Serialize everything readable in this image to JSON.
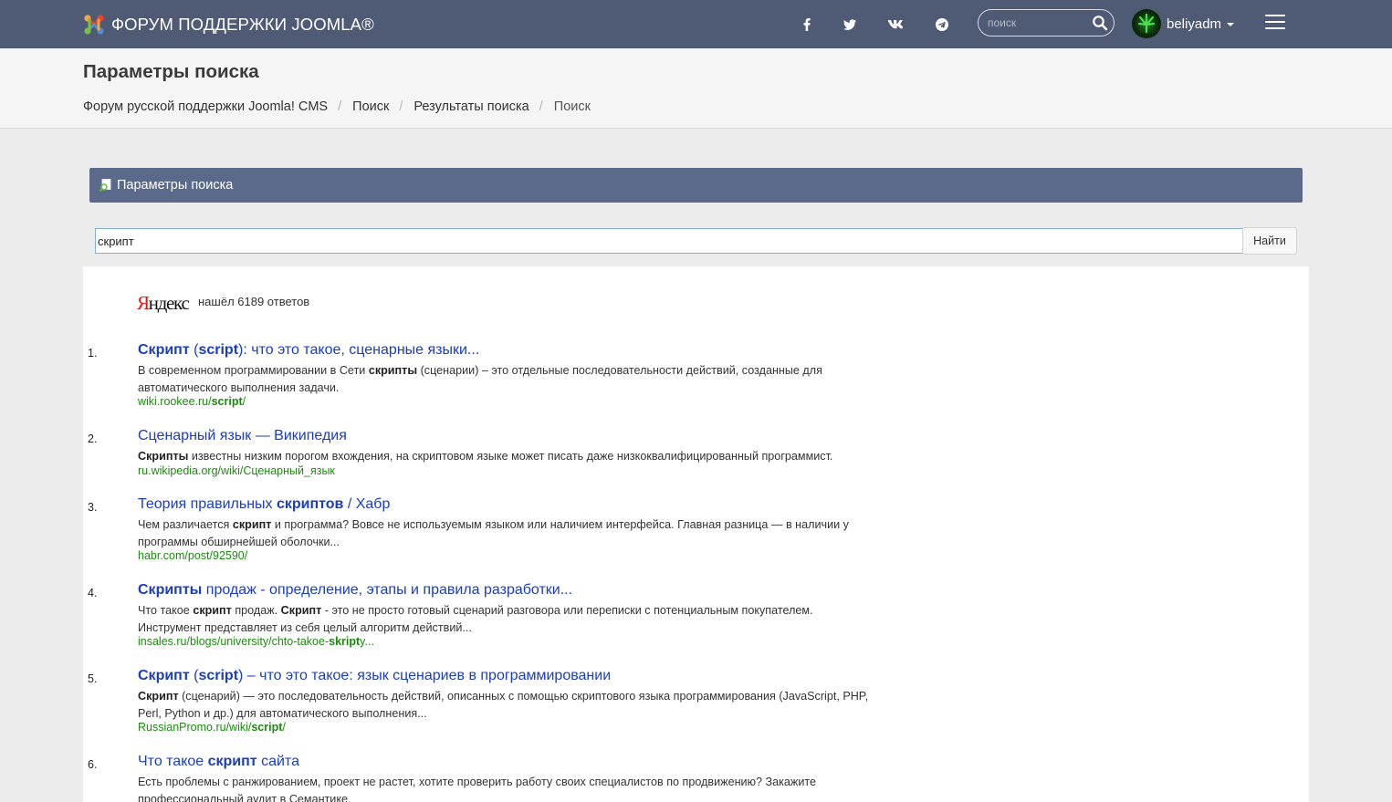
{
  "navbar": {
    "brand": "ФОРУМ ПОДДЕРЖКИ JOOMLA®",
    "social": [
      "facebook-icon",
      "twitter-icon",
      "vk-icon",
      "telegram-icon"
    ],
    "search_placeholder": "поиск",
    "username": "beliyadm"
  },
  "header": {
    "title": "Параметры поиска",
    "breadcrumbs": [
      "Форум русской поддержки Joomla! CMS",
      "Поиск",
      "Результаты поиска",
      "Поиск"
    ]
  },
  "panel": {
    "title": "Параметры поиска",
    "query": "скрипт",
    "button": "Найти"
  },
  "yandex": {
    "logo": "Яндекс",
    "found": "нашёл 6189 ответов"
  },
  "results": [
    {
      "num": "1.",
      "title": [
        [
          "b",
          "Скрипт"
        ],
        [
          "t",
          " ("
        ],
        [
          "b",
          "script"
        ],
        [
          "t",
          "): что это такое, сценарные языки..."
        ]
      ],
      "snippet": [
        [
          "t",
          "В современном программировании в Сети "
        ],
        [
          "b",
          "скрипты"
        ],
        [
          "t",
          " (сценарии) – это отдельные последовательности действий, созданные для автоматического выполнения задачи."
        ]
      ],
      "url": [
        [
          "t",
          "wiki.rookee.ru/"
        ],
        [
          "b",
          "script"
        ],
        [
          "t",
          "/"
        ]
      ]
    },
    {
      "num": "2.",
      "title": [
        [
          "t",
          "Сценарный язык — Википедия"
        ]
      ],
      "snippet": [
        [
          "b",
          "Скрипты"
        ],
        [
          "t",
          " известны низким порогом вхождения, на скриптовом языке может писать даже низкоквалифицированный программист."
        ]
      ],
      "url": [
        [
          "t",
          "ru.wikipedia.org/wiki/Сценарный_язык"
        ]
      ]
    },
    {
      "num": "3.",
      "title": [
        [
          "t",
          "Теория правильных "
        ],
        [
          "b",
          "скриптов"
        ],
        [
          "t",
          " / Хабр"
        ]
      ],
      "snippet": [
        [
          "t",
          "Чем различается "
        ],
        [
          "b",
          "скрипт"
        ],
        [
          "t",
          " и программа? Вовсе не используемым языком или наличием интерфейса. Главная разница — в наличии у программы обширнейшей оболочки..."
        ]
      ],
      "url": [
        [
          "t",
          "habr.com/post/92590/"
        ]
      ]
    },
    {
      "num": "4.",
      "title": [
        [
          "b",
          "Скрипты"
        ],
        [
          "t",
          " продаж - определение, этапы и правила разработки..."
        ]
      ],
      "snippet": [
        [
          "t",
          "Что такое "
        ],
        [
          "b",
          "скрипт"
        ],
        [
          "t",
          " продаж. "
        ],
        [
          "b",
          "Скрипт"
        ],
        [
          "t",
          " - это не просто готовый сценарий разговора или переписки с потенциальным покупателем. Инструмент представляет из себя целый алгоритм действий..."
        ]
      ],
      "url": [
        [
          "t",
          "insales.ru/blogs/university/chto-takoe-"
        ],
        [
          "b",
          "skript"
        ],
        [
          "t",
          "y..."
        ]
      ]
    },
    {
      "num": "5.",
      "title": [
        [
          "b",
          "Скрипт"
        ],
        [
          "t",
          " ("
        ],
        [
          "b",
          "script"
        ],
        [
          "t",
          ") – что это такое: язык сценариев в программировании"
        ]
      ],
      "snippet": [
        [
          "b",
          "Скрипт"
        ],
        [
          "t",
          " (сценарий) — это последовательность действий, описанных с помощью скриптового языка программирования (JavaScript, PHP, Perl, Python и др.) для автоматического выполнения..."
        ]
      ],
      "url": [
        [
          "t",
          "RussianPromo.ru/wiki/"
        ],
        [
          "b",
          "script"
        ],
        [
          "t",
          "/"
        ]
      ]
    },
    {
      "num": "6.",
      "title": [
        [
          "t",
          "Что такое "
        ],
        [
          "b",
          "скрипт"
        ],
        [
          "t",
          " сайта"
        ]
      ],
      "snippet": [
        [
          "t",
          "Есть проблемы с ранжированием, проект не растет, хотите проверить работу своих специалистов по продвижению? Закажите профессиональный аудит в Семантике."
        ]
      ],
      "url": []
    }
  ]
}
